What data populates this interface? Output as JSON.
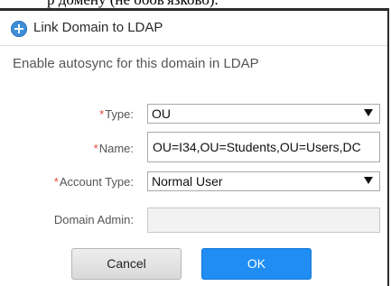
{
  "background_text": "р домену (не обов'язково).",
  "dialog": {
    "title": "Link Domain to LDAP",
    "subtitle": "Enable autosync for this domain in LDAP"
  },
  "form": {
    "required_mark": "*",
    "type_label": "Type:",
    "type_value": "OU",
    "name_label": "Name:",
    "name_value": "OU=I34,OU=Students,OU=Users,DC",
    "account_type_label": "Account Type:",
    "account_type_value": "Normal User",
    "domain_admin_label": "Domain Admin:",
    "domain_admin_value": ""
  },
  "buttons": {
    "cancel": "Cancel",
    "ok": "OK"
  },
  "colors": {
    "accent": "#1f8df4",
    "required": "#e0473b",
    "title_icon": "#3f8fd8"
  },
  "icons": {
    "title": "add-circle-icon",
    "dropdown": "dropdown-arrow-icon"
  }
}
